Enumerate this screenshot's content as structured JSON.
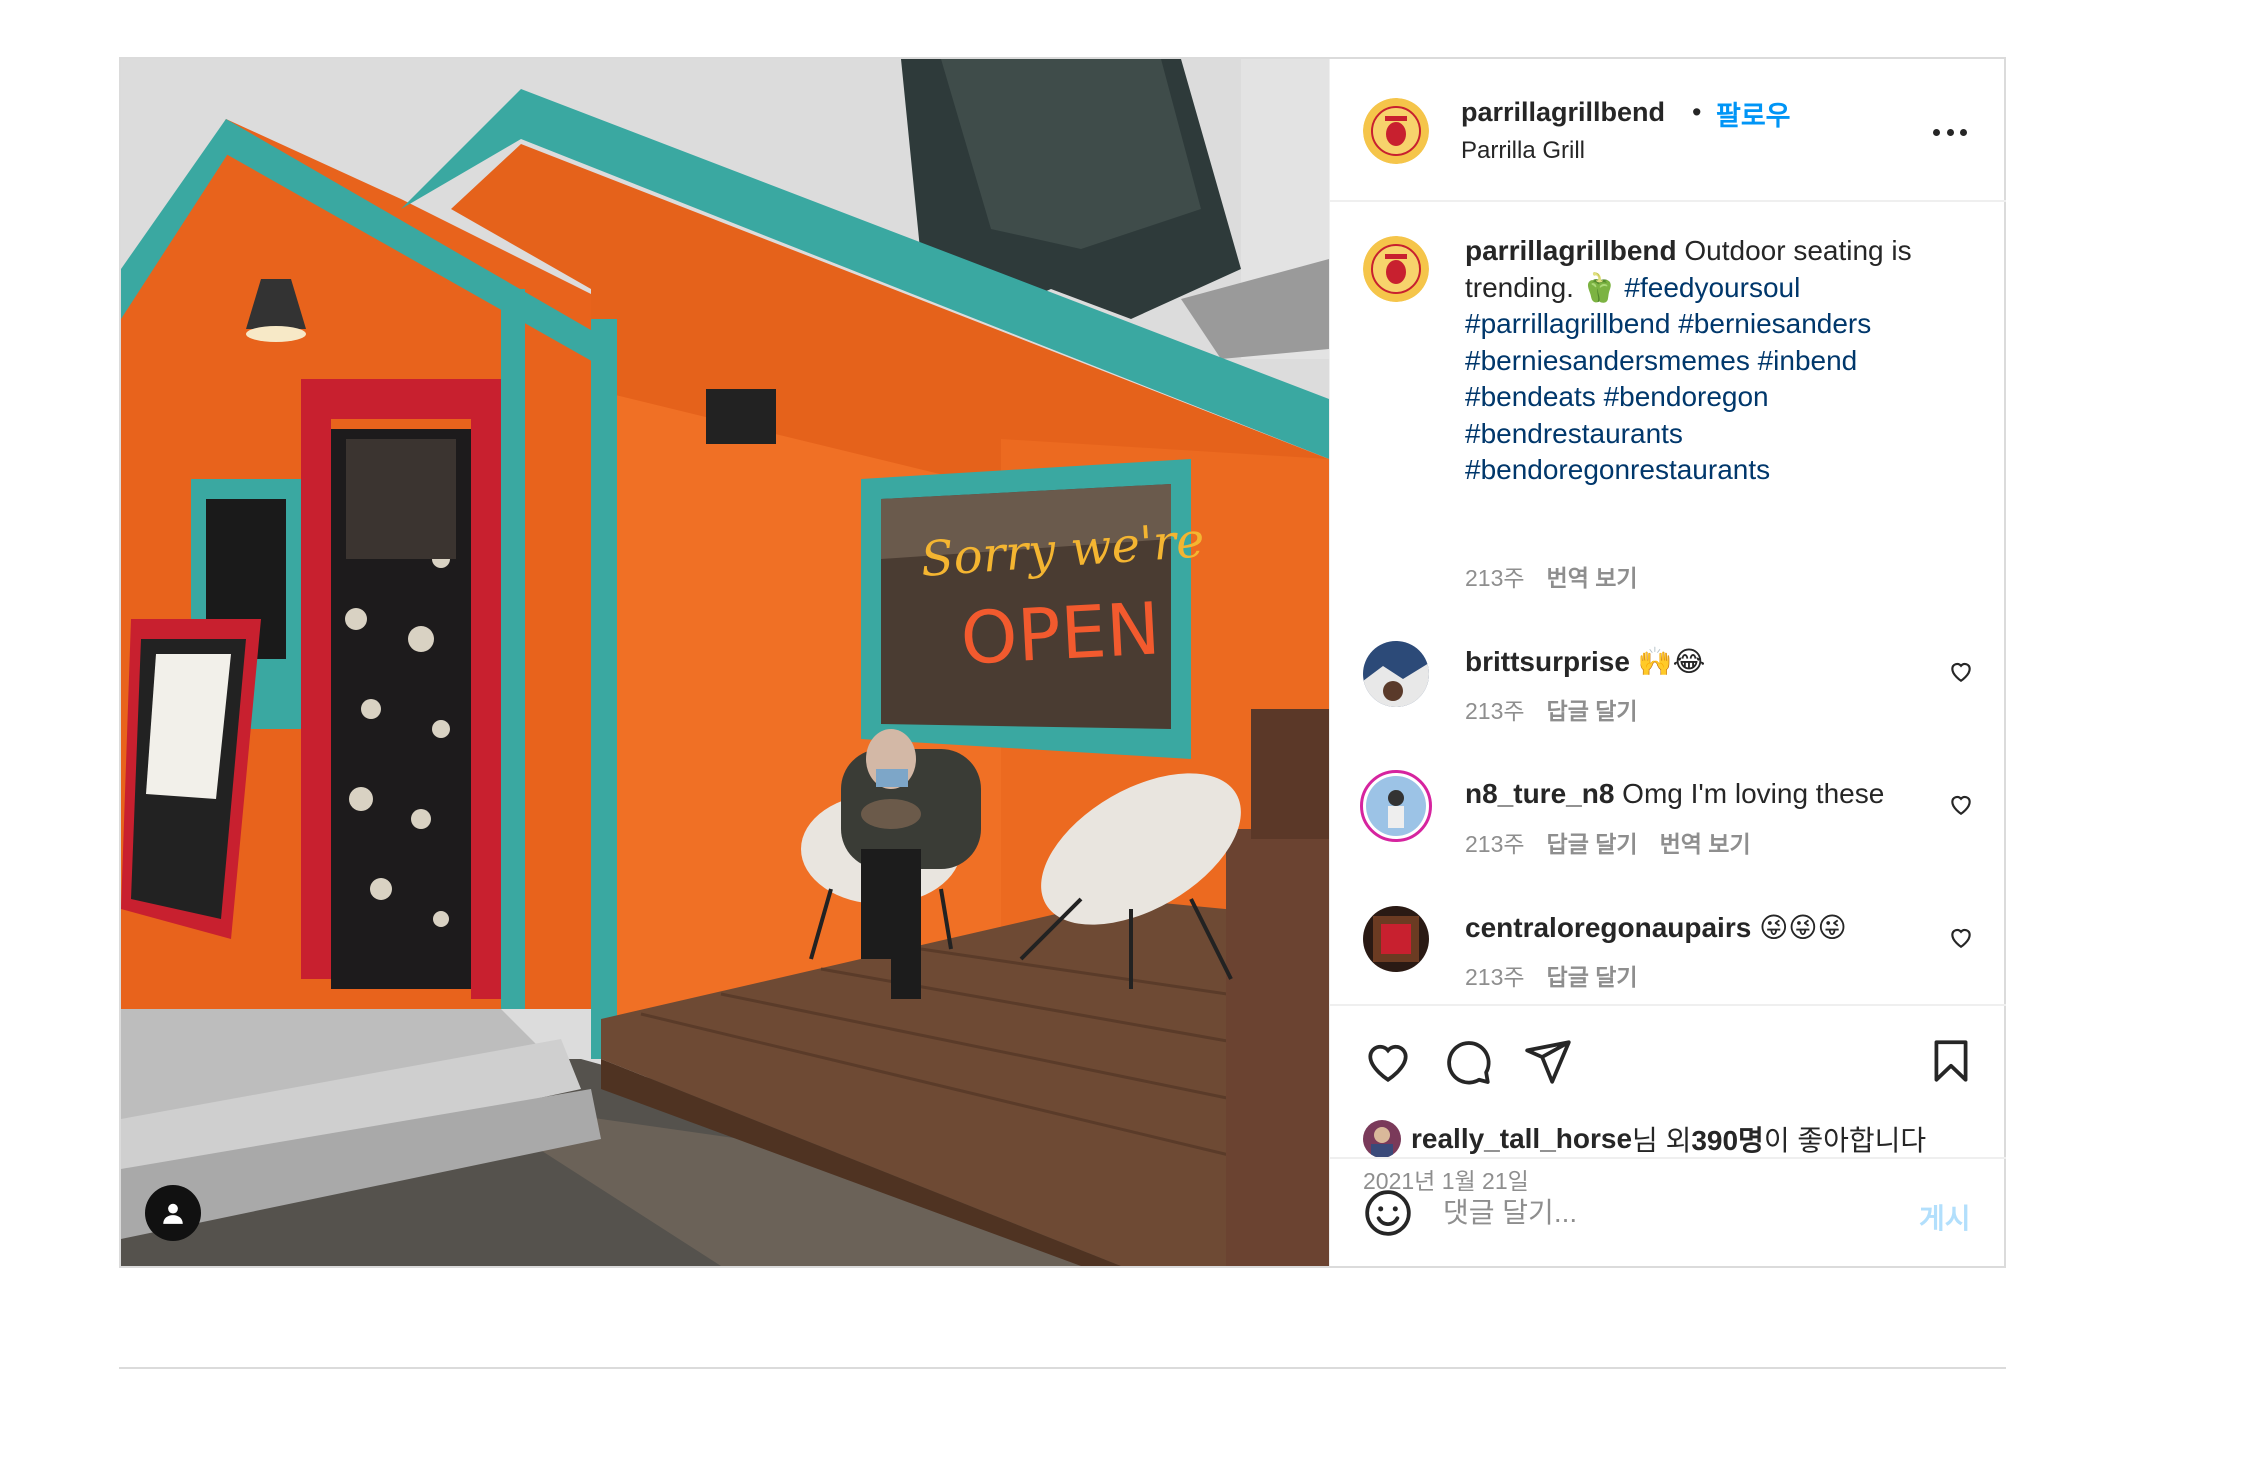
{
  "header": {
    "username": "parrillagrillbend",
    "separator": "•",
    "follow_label": "팔로우",
    "subtitle": "Parrilla Grill",
    "more_icon": "more-horizontal-icon"
  },
  "photo": {
    "sign_line1": "Sorry we're",
    "sign_line2": "OPEN",
    "user_tag_icon": "person-icon"
  },
  "caption": {
    "username": "parrillagrillbend",
    "text": " Outdoor seating is trending. ",
    "emoji": "🫑",
    "hashtags": [
      "#feedyoursoul",
      "#parrillagrillbend",
      "#berniesanders",
      "#berniesandersmemes",
      "#inbend",
      "#bendeats",
      "#bendoregon",
      "#bendrestaurants",
      "#bendoregonrestaurants"
    ],
    "age": "213주",
    "translate_label": "번역 보기"
  },
  "comments": [
    {
      "username": "brittsurprise",
      "text": " 🙌😂",
      "age": "213주",
      "reply_label": "답글 달기",
      "translate_label": ""
    },
    {
      "username": "n8_ture_n8",
      "text": " Omg I'm loving these",
      "age": "213주",
      "reply_label": "답글 달기",
      "translate_label": "번역 보기"
    },
    {
      "username": "centraloregonaupairs",
      "text": " 😜😜😜",
      "age": "213주",
      "reply_label": "답글 달기",
      "translate_label": ""
    }
  ],
  "actions": {
    "like_icon": "heart-icon",
    "comment_icon": "comment-icon",
    "share_icon": "send-icon",
    "save_icon": "bookmark-icon"
  },
  "likes": {
    "liker": "really_tall_horse",
    "mid": "님 외 ",
    "count": "390명",
    "suffix": "이 좋아합니다"
  },
  "date": "2021년 1월 21일",
  "comment_box": {
    "emoji_icon": "smiley-icon",
    "placeholder": "댓글 달기...",
    "post_label": "게시"
  },
  "colors": {
    "accent": "#0095f6",
    "hashtag": "#00376b",
    "muted": "#8e8e8e",
    "border": "#dbdbdb",
    "post_disabled": "#b2dffc"
  }
}
